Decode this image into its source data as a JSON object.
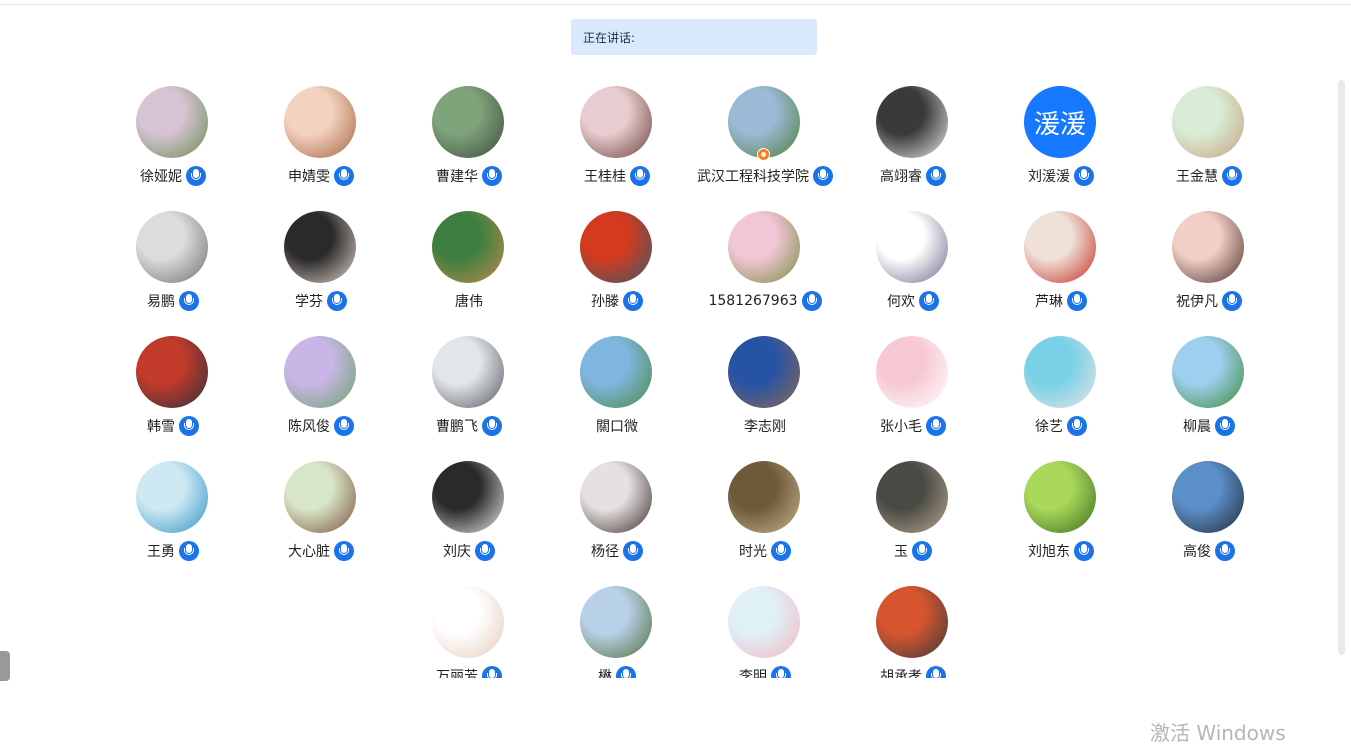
{
  "speaking": {
    "label": "正在讲话:"
  },
  "watermark": {
    "text": "激活 Windows"
  },
  "colors": {
    "mic": "#1a73e8",
    "speaking_bg": "#dbe9ff",
    "host_badge": "#ff7a1a"
  },
  "participants": [
    {
      "name": "徐娅妮",
      "mic": true,
      "c1": "#d6c4d2",
      "c2": "#6b8a55"
    },
    {
      "name": "申婧雯",
      "mic": true,
      "c1": "#f3d2c0",
      "c2": "#a4623f"
    },
    {
      "name": "曹建华",
      "mic": true,
      "c1": "#7fa37a",
      "c2": "#3c4a3d"
    },
    {
      "name": "王桂桂",
      "mic": true,
      "c1": "#e8cdd0",
      "c2": "#6a3e3a"
    },
    {
      "name": "武汉工程科技学院",
      "mic": true,
      "host": true,
      "c1": "#9cb9d6",
      "c2": "#4f7d35"
    },
    {
      "name": "高翊睿",
      "mic": true,
      "c1": "#3a3a3a",
      "c2": "#e9e9e9"
    },
    {
      "name": "刘湲湲",
      "mic": true,
      "text_avatar": "湲湲"
    },
    {
      "name": "王金慧",
      "mic": true,
      "c1": "#d9ecd6",
      "c2": "#c7a27e"
    },
    {
      "name": "易鹏",
      "mic": true,
      "c1": "#dcdcdc",
      "c2": "#6e6e6e"
    },
    {
      "name": "学芬",
      "mic": true,
      "c1": "#2a2a2a",
      "c2": "#e2d3c8"
    },
    {
      "name": "唐伟",
      "mic": false,
      "c1": "#3d7f3f",
      "c2": "#c28a4d"
    },
    {
      "name": "孙滕",
      "mic": true,
      "c1": "#d33a1e",
      "c2": "#3b5a6b"
    },
    {
      "name": "1581267963",
      "mic": true,
      "c1": "#f1c6d6",
      "c2": "#7a8b3e"
    },
    {
      "name": "何欢",
      "mic": true,
      "c1": "#ffffff",
      "c2": "#6a6a8a"
    },
    {
      "name": "芦琳",
      "mic": true,
      "c1": "#efe1d8",
      "c2": "#c42a1f"
    },
    {
      "name": "祝伊凡",
      "mic": true,
      "c1": "#f1cfc7",
      "c2": "#4a2f2a"
    },
    {
      "name": "韩雪",
      "mic": true,
      "c1": "#c23b2b",
      "c2": "#2f2f3c"
    },
    {
      "name": "陈风俊",
      "mic": true,
      "c1": "#c9b6e6",
      "c2": "#6aa36b"
    },
    {
      "name": "曹鹏飞",
      "mic": true,
      "c1": "#e2e6ea",
      "c2": "#555a5f"
    },
    {
      "name": "關口微",
      "mic": false,
      "c1": "#7fb6e0",
      "c2": "#4b8a3e"
    },
    {
      "name": "李志刚",
      "mic": false,
      "c1": "#2753a5",
      "c2": "#8c6a54"
    },
    {
      "name": "张小毛",
      "mic": true,
      "c1": "#f6c9d2",
      "c2": "#ffffff"
    },
    {
      "name": "徐艺",
      "mic": true,
      "c1": "#7ad0e6",
      "c2": "#e6e6e6"
    },
    {
      "name": "柳晨",
      "mic": true,
      "c1": "#9ecfef",
      "c2": "#3c8a35"
    },
    {
      "name": "王勇",
      "mic": true,
      "c1": "#cfe9f3",
      "c2": "#2d93c7"
    },
    {
      "name": "大心脏",
      "mic": true,
      "c1": "#d8e6c8",
      "c2": "#7b4f3a"
    },
    {
      "name": "刘庆",
      "mic": true,
      "c1": "#2a2a2a",
      "c2": "#eaeaea"
    },
    {
      "name": "杨径",
      "mic": true,
      "c1": "#e6e1e1",
      "c2": "#3a2a2a"
    },
    {
      "name": "时光",
      "mic": true,
      "c1": "#6e5a3a",
      "c2": "#c9b58e"
    },
    {
      "name": "玉",
      "mic": true,
      "c1": "#4a4a44",
      "c2": "#b8a892"
    },
    {
      "name": "刘旭东",
      "mic": true,
      "c1": "#a9d85b",
      "c2": "#3a6b1e"
    },
    {
      "name": "高俊",
      "mic": true,
      "c1": "#5c8fc9",
      "c2": "#202a35"
    },
    {
      "name": "万丽芳",
      "mic": true,
      "c1": "#ffffff",
      "c2": "#e7c9b9"
    },
    {
      "name": "楙",
      "mic": true,
      "c1": "#b8d0e8",
      "c2": "#4f6e38"
    },
    {
      "name": "李明",
      "mic": true,
      "c1": "#dff0f7",
      "c2": "#f4b6c0"
    },
    {
      "name": "胡承孝",
      "mic": true,
      "c1": "#d6552f",
      "c2": "#3a3a3a"
    }
  ]
}
